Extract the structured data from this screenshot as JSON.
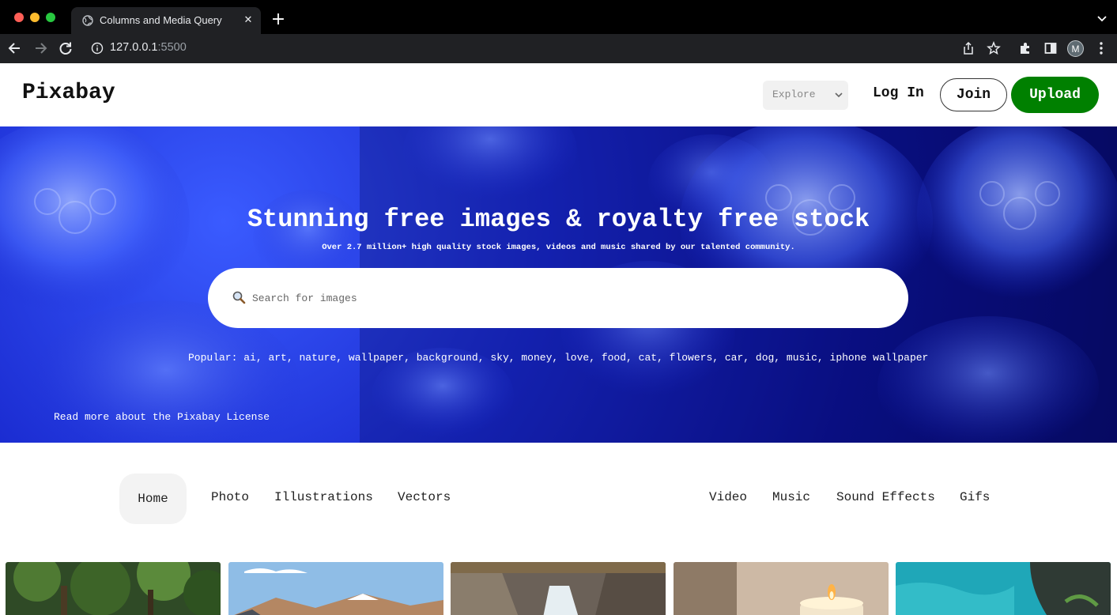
{
  "browser": {
    "tab_title": "Columns and Media Query",
    "url_host": "127.0.0.1",
    "url_port": ":5500",
    "profile_initial": "M"
  },
  "header": {
    "logo": "Pixabay",
    "explore_label": "Explore",
    "login_label": "Log In",
    "join_label": "Join",
    "upload_label": "Upload",
    "upload_color": "#008000"
  },
  "hero": {
    "title": "Stunning free images & royalty free stock",
    "subtitle": "Over 2.7 million+ high quality stock images, videos and music shared by our talented community.",
    "search_placeholder": "Search for images",
    "popular_label": "Popular:",
    "popular_tags": [
      "ai",
      "art",
      "nature",
      "wallpaper",
      "background",
      "sky",
      "money",
      "love",
      "food",
      "cat",
      "flowers",
      "car",
      "dog",
      "music",
      "iphone wallpaper"
    ],
    "license_link": "Read more about the Pixabay License"
  },
  "categories": {
    "left": [
      "Home",
      "Photo",
      "Illustrations",
      "Vectors"
    ],
    "right": [
      "Video",
      "Music",
      "Sound Effects",
      "Gifs"
    ],
    "active": "Home"
  },
  "gallery": {
    "thumbnails": [
      "forest-icon",
      "mountain-lake-icon",
      "waterfall-icon",
      "candle-icon",
      "ocean-coast-icon"
    ]
  }
}
